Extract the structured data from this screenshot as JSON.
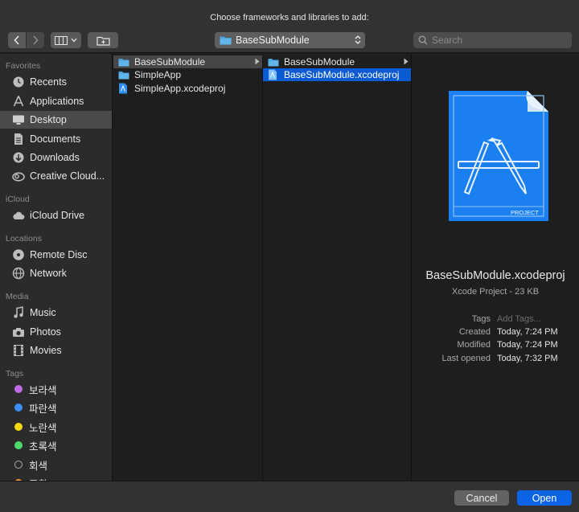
{
  "dialog": {
    "title": "Choose frameworks and libraries to add:"
  },
  "toolbar": {
    "back_icon": "chevron-left-icon",
    "forward_icon": "chevron-right-icon",
    "view_icon": "column-view-icon",
    "new_folder_icon": "new-folder-icon",
    "location": "BaseSubModule",
    "search_placeholder": "Search"
  },
  "sidebar": {
    "favorites_header": "Favorites",
    "favorites": [
      {
        "label": "Recents",
        "icon": "clock-icon"
      },
      {
        "label": "Applications",
        "icon": "applications-icon"
      },
      {
        "label": "Desktop",
        "icon": "desktop-icon",
        "selected": true
      },
      {
        "label": "Documents",
        "icon": "document-icon"
      },
      {
        "label": "Downloads",
        "icon": "download-icon"
      },
      {
        "label": "Creative Cloud...",
        "icon": "creative-cloud-icon"
      }
    ],
    "icloud_header": "iCloud",
    "icloud": [
      {
        "label": "iCloud Drive",
        "icon": "cloud-icon"
      }
    ],
    "locations_header": "Locations",
    "locations": [
      {
        "label": "Remote Disc",
        "icon": "disc-icon"
      },
      {
        "label": "Network",
        "icon": "globe-icon"
      }
    ],
    "media_header": "Media",
    "media": [
      {
        "label": "Music",
        "icon": "music-icon"
      },
      {
        "label": "Photos",
        "icon": "camera-icon"
      },
      {
        "label": "Movies",
        "icon": "film-icon"
      }
    ],
    "tags_header": "Tags",
    "tags": [
      {
        "label": "보라색",
        "color": "#c16ae8"
      },
      {
        "label": "파란색",
        "color": "#3d8ef5"
      },
      {
        "label": "노란색",
        "color": "#f5d90f"
      },
      {
        "label": "초록색",
        "color": "#4fd96a"
      },
      {
        "label": "회색",
        "color": "hollow"
      },
      {
        "label": "주황",
        "color": "#f59b24"
      }
    ]
  },
  "columns": {
    "col1": [
      {
        "label": "BaseSubModule",
        "type": "folder",
        "selected": true,
        "has_children": true
      },
      {
        "label": "SimpleApp",
        "type": "folder"
      },
      {
        "label": "SimpleApp.xcodeproj",
        "type": "xcodeproj"
      }
    ],
    "col2": [
      {
        "label": "BaseSubModule",
        "type": "folder",
        "has_children": true
      },
      {
        "label": "BaseSubModule.xcodeproj",
        "type": "xcodeproj",
        "selected": true
      }
    ]
  },
  "preview": {
    "icon": "xcode-project-icon",
    "icon_badge": "PROJECT",
    "name": "BaseSubModule.xcodeproj",
    "kind": "Xcode Project - 23 KB",
    "tags_label": "Tags",
    "tags_placeholder": "Add Tags...",
    "created_label": "Created",
    "created_value": "Today, 7:24 PM",
    "modified_label": "Modified",
    "modified_value": "Today, 7:24 PM",
    "opened_label": "Last opened",
    "opened_value": "Today, 7:32 PM"
  },
  "buttons": {
    "cancel": "Cancel",
    "open": "Open"
  },
  "colors": {
    "accent": "#0b63e6",
    "selection": "#0b5bd3",
    "folder": "#4aa3dc"
  }
}
